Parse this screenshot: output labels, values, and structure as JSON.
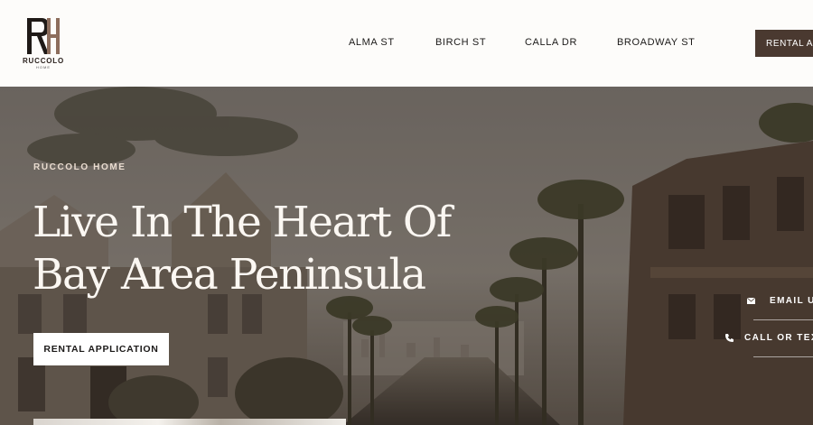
{
  "brand": {
    "logo_mark": "RH",
    "name": "RUCCOLO",
    "sub": "HOME"
  },
  "nav": {
    "items": [
      {
        "label": "ALMA ST"
      },
      {
        "label": "BIRCH ST"
      },
      {
        "label": "CALLA DR"
      },
      {
        "label": "BROADWAY ST"
      }
    ],
    "cta_label": "RENTAL AP"
  },
  "hero": {
    "eyebrow": "RUCCOLO HOME",
    "headline_line1": "Live In The Heart Of",
    "headline_line2": "Bay Area Peninsula",
    "cta_label": "RENTAL APPLICATION"
  },
  "contact": {
    "email_label": "EMAIL U",
    "call_label": "CALL OR TEX",
    "email_icon": "envelope-icon",
    "call_icon": "phone-icon"
  },
  "colors": {
    "accent_brown": "#4a3930",
    "header_bg": "#fdfcfa",
    "headline": "#fbf7f2"
  }
}
